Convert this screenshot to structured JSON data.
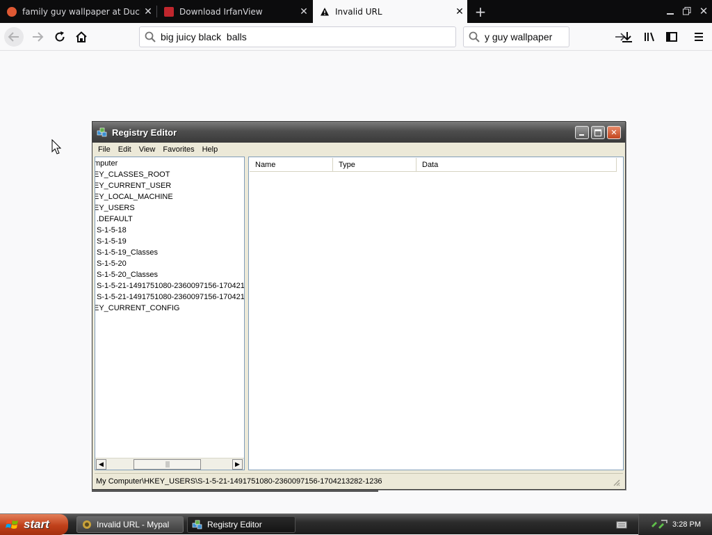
{
  "browser": {
    "tabs": [
      {
        "title": "family guy wallpaper at DuckDuckGo",
        "active": false,
        "icon": "duckduckgo-icon"
      },
      {
        "title": "Download IrfanView",
        "active": false,
        "icon": "irfanview-icon"
      },
      {
        "title": "Invalid URL",
        "active": true,
        "icon": "warning-icon"
      }
    ],
    "new_tab_icon": "plus-icon",
    "url": "big juicy black  balls",
    "search_value": "y guy wallpaper"
  },
  "registry": {
    "title": "Registry Editor",
    "menu": [
      "File",
      "Edit",
      "View",
      "Favorites",
      "Help"
    ],
    "tree": [
      "mputer",
      "EY_CLASSES_ROOT",
      "EY_CURRENT_USER",
      "EY_LOCAL_MACHINE",
      "EY_USERS",
      ".DEFAULT",
      "S-1-5-18",
      "S-1-5-19",
      "S-1-5-19_Classes",
      "S-1-5-20",
      "S-1-5-20_Classes",
      "S-1-5-21-1491751080-2360097156-170421",
      "S-1-5-21-1491751080-2360097156-170421",
      "EY_CURRENT_CONFIG"
    ],
    "columns": [
      "Name",
      "Type",
      "Data"
    ],
    "status": "My Computer\\HKEY_USERS\\S-1-5-21-1491751080-2360097156-1704213282-1236"
  },
  "taskbar": {
    "start_label": "start",
    "items": [
      {
        "label": "Invalid URL - Mypal",
        "active": false
      },
      {
        "label": "Registry Editor",
        "active": true
      }
    ],
    "clock": "3:28 PM"
  }
}
